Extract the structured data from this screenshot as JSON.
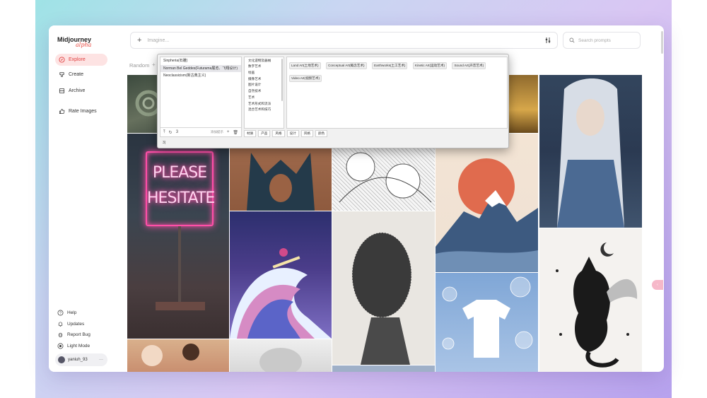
{
  "app": {
    "logo_name": "Midjourney",
    "logo_sub": "alpha"
  },
  "sidebar": {
    "items": [
      {
        "label": "Explore",
        "icon": "compass-icon",
        "active": true
      },
      {
        "label": "Create",
        "icon": "brush-icon",
        "active": false
      },
      {
        "label": "Archive",
        "icon": "archive-icon",
        "active": false
      },
      {
        "label": "Rate Images",
        "icon": "thumbs-up-icon",
        "active": false
      }
    ],
    "bottom": [
      {
        "label": "Help",
        "icon": "help-icon"
      },
      {
        "label": "Updates",
        "icon": "bell-icon"
      },
      {
        "label": "Report Bug",
        "icon": "bug-icon"
      },
      {
        "label": "Light Mode",
        "icon": "sun-icon"
      }
    ],
    "user": {
      "name": "yaniuh_93",
      "menu": "···"
    }
  },
  "topbar": {
    "imagine_placeholder": "Imagine...",
    "search_placeholder": "Search prompts"
  },
  "feed": {
    "filter_label": "Random",
    "neon_sign_line1": "PLEASE",
    "neon_sign_line2": "HESITATE"
  },
  "popup": {
    "list1": [
      {
        "label": "Sinpheria(石雕)",
        "selected": false
      },
      {
        "label": "Norman Bel Geddes(Futurama展览、飞翔设计)",
        "selected": true
      },
      {
        "label": "Neoclassicism(新古典主义)",
        "selected": false
      }
    ],
    "list1_tools": {
      "upload": "⤒",
      "refresh": "↻",
      "count": "3",
      "label": "添加提示",
      "add": "+",
      "trash": "🗑"
    },
    "list2": [
      "文化遗物及器械",
      "数字艺术",
      "绘画",
      "摄像艺术",
      "图片设计",
      "自然技术",
      "艺术",
      "艺术形式和流派",
      "混合艺术和技巧"
    ],
    "tags": [
      "Land Art(土地艺术)",
      "Conceptual Art(概念艺术)",
      "Earthworks(土工艺术)",
      "Kinetic Art(运动艺术)",
      "Sound Art(声音艺术)",
      "Video Art(视频艺术)"
    ],
    "tabs": [
      "材质",
      "产品",
      "风格",
      "设计",
      "风格",
      "颜色"
    ],
    "input_value": "3|"
  },
  "colors": {
    "accent": "#e04040",
    "active_bg": "#fde3e3",
    "neon_pink": "#ff4fa8"
  }
}
